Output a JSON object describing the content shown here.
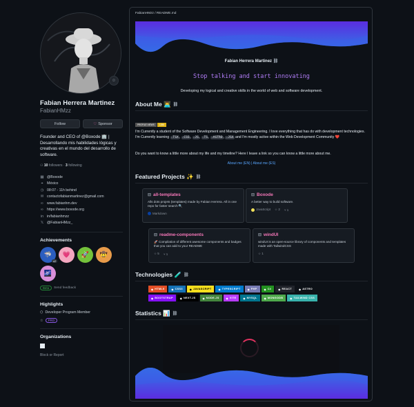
{
  "profile": {
    "full_name": "Fabian Herrera Martinez",
    "username": "FabianHMzz",
    "follow_label": "Follow",
    "sponsor_label": "Sponsor",
    "bio": "Founder and CEO of @Boxode 🏢 | Desarrollando mis habilidades lógicas y creativas en el mundo del desarrollo de software.",
    "followers": "10",
    "followers_label": "followers",
    "following": "3",
    "following_label": "following",
    "info": [
      {
        "icon": "org-icon",
        "glyph": "▦",
        "text": "@Boxode"
      },
      {
        "icon": "location-icon",
        "glyph": "⌖",
        "text": "México"
      },
      {
        "icon": "clock-icon",
        "glyph": "◷",
        "text": "08:07 - 11h behind"
      },
      {
        "icon": "mail-icon",
        "glyph": "✉",
        "text": "contactofabianmartinez@gmail.com"
      },
      {
        "icon": "link-icon",
        "glyph": "∞",
        "text": "www.fabianhm.dev"
      },
      {
        "icon": "link-icon",
        "glyph": "∞",
        "text": "https://www.boxode.org"
      },
      {
        "icon": "linkedin-icon",
        "glyph": "in",
        "text": "in/fabianhmzz"
      },
      {
        "icon": "x-icon",
        "glyph": "𝕏",
        "text": "@FabianHMzz_"
      }
    ]
  },
  "achievements": {
    "title": "Achievements",
    "items": [
      {
        "name": "achievement-pull-shark",
        "emoji": "🦈",
        "bg": "#2b5dbf",
        "count": "x2"
      },
      {
        "name": "achievement-heart",
        "emoji": "💗",
        "bg": "#f4a7c0",
        "count": ""
      },
      {
        "name": "achievement-yolo",
        "emoji": "🚀",
        "bg": "#74c23b",
        "count": ""
      },
      {
        "name": "achievement-quickdraw",
        "emoji": "🤠",
        "bg": "#e89b4a",
        "count": ""
      },
      {
        "name": "achievement-galaxy",
        "emoji": "🌌",
        "bg": "#d98fd9",
        "count": ""
      }
    ],
    "beta_label": "Beta",
    "send_feedback": "Send feedback"
  },
  "highlights": {
    "title": "Highlights",
    "items": [
      {
        "icon": "developer-program-icon",
        "glyph": "⬡",
        "text": "Developer Program Member"
      },
      {
        "icon": "star-icon",
        "glyph": "☆",
        "text": "PRO"
      }
    ]
  },
  "organizations": {
    "title": "Organizations"
  },
  "block_report": "Block or Report",
  "readme": {
    "path": "FabianHMzz / README.md",
    "name": "Fabian Herrera Martinez",
    "typing_text": "Stop talking and start innovating",
    "tagline": "Developing my logical and creative skills in the world of web and software development.",
    "about_title": "About Me 👨‍💻",
    "badges": [
      {
        "label": "PROFILE VIEWS",
        "color": "#555555"
      },
      {
        "label": "1288",
        "color": "#dfb317"
      }
    ],
    "about_p1_a": "I'm Currently a student of the Software Development and Management Engineering. I love everything that has do with development technologies. I'm Currently learning",
    "about_codes": [
      ".TSX",
      ".CSS",
      ".JS",
      ".TS",
      ".ASTRO",
      ".JSX"
    ],
    "about_p1_b": "and I'm mostly active within the Web Development Community ❤️",
    "about_p2": "Do you want to know a little more about my life and my timeline? Here I leave a link so you can know a little more about me.",
    "about_links": "About me (EN) | About me (ES)",
    "projects_title": "Featured Projects ✨",
    "projects": [
      {
        "name": "all-templates",
        "desc": "Alls dots projets (templates) made by Fabian Herrera. All in one repo for faster search 🔍",
        "lang": "Markdown",
        "lang_color": "#083fa1",
        "stars": "",
        "forks": ""
      },
      {
        "name": "Boxode",
        "desc": "A better way to build software.",
        "lang": "JavaScript",
        "lang_color": "#f1e05a",
        "stars": "2",
        "forks": "1"
      },
      {
        "name": "readme-components",
        "desc": "🚀 Compilation of different awesome components and badges that you can add to your README",
        "lang": "",
        "lang_color": "",
        "stars": "5",
        "forks": "1"
      },
      {
        "name": "windUI",
        "desc": "windUI is an open-source library of components and templates made with TailwindCSS",
        "lang": "",
        "lang_color": "",
        "stars": "1",
        "forks": ""
      }
    ],
    "tech_title": "Technologies 🧪",
    "tech_row1": [
      {
        "label": "HTML5",
        "color": "#e34f26",
        "icon": "html5-icon"
      },
      {
        "label": "CSS3",
        "color": "#1572b6",
        "icon": "css3-icon"
      },
      {
        "label": "JAVASCRIPT",
        "color": "#f7df1e",
        "icon": "javascript-icon",
        "fg": "#000000"
      },
      {
        "label": "TYPESCRIPT",
        "color": "#007acc",
        "icon": "typescript-icon"
      },
      {
        "label": "PHP",
        "color": "#777bb4",
        "icon": "php-icon"
      },
      {
        "label": "C#",
        "color": "#239120",
        "icon": "csharp-icon"
      },
      {
        "label": "REACT",
        "color": "#20232a",
        "icon": "react-icon"
      },
      {
        "label": "ASTRO",
        "color": "#0d1117",
        "icon": "astro-icon"
      }
    ],
    "tech_row2": [
      {
        "label": "BOOTSTRAP",
        "color": "#8511fa",
        "icon": "bootstrap-icon"
      },
      {
        "label": "NEXT.JS",
        "color": "#000000",
        "icon": "nextjs-icon"
      },
      {
        "label": "NODE.JS",
        "color": "#43853d",
        "icon": "nodejs-icon"
      },
      {
        "label": "VITE",
        "color": "#b73bfe",
        "icon": "vite-icon"
      },
      {
        "label": "MYSQL",
        "color": "#00758f",
        "icon": "mysql-icon"
      },
      {
        "label": "MONGODB",
        "color": "#4ea94b",
        "icon": "mongodb-icon"
      },
      {
        "label": "TAILWIND CSS",
        "color": "#38b2ac",
        "icon": "tailwind-icon"
      }
    ],
    "stats_title": "Statistics 📊"
  },
  "colors": {
    "accent": "#58a6ff",
    "wave_top": "#5b2de0",
    "wave_bottom": "#2f7be8",
    "project_title": "#f778ba"
  }
}
